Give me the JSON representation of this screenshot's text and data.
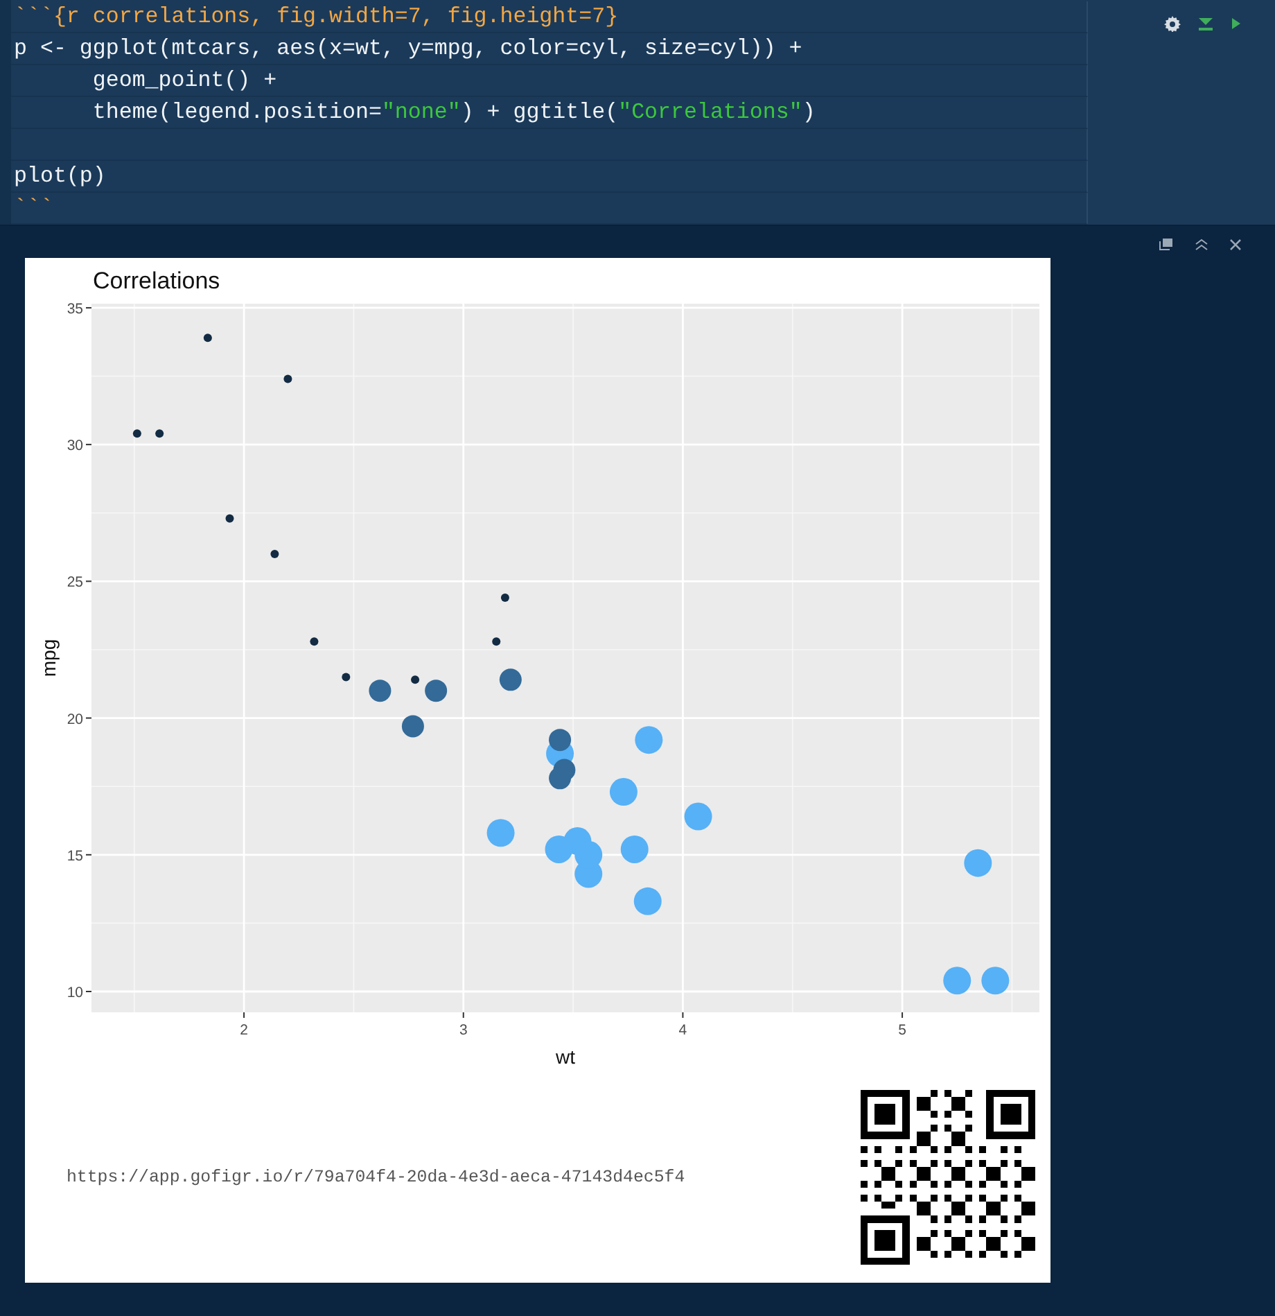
{
  "editor": {
    "lines": [
      [
        {
          "kind": "chunk",
          "text": "```{r correlations, fig.width=7, fig.height=7}"
        }
      ],
      [
        {
          "kind": "plain",
          "text": "p <- ggplot(mtcars, aes(x=wt, y=mpg, color=cyl, size=cyl)) +"
        }
      ],
      [
        {
          "kind": "plain",
          "text": "      geom_point() +"
        }
      ],
      [
        {
          "kind": "plain",
          "text": "      theme(legend.position="
        },
        {
          "kind": "string",
          "text": "\"none\""
        },
        {
          "kind": "plain",
          "text": ") + ggtitle("
        },
        {
          "kind": "string",
          "text": "\"Correlations\""
        },
        {
          "kind": "plain",
          "text": ")"
        }
      ],
      {
        "kind": "blank"
      },
      [
        {
          "kind": "plain",
          "text": "plot(p)"
        }
      ],
      [
        {
          "kind": "chunk",
          "text": "```"
        }
      ]
    ]
  },
  "output": {
    "chart_data": {
      "type": "scatter",
      "grid": true,
      "title": "Correlations",
      "xlabel": "wt",
      "ylabel": "mpg",
      "xlim": [
        1.305,
        5.625
      ],
      "ylim": [
        9.24,
        35.15
      ],
      "xticks": [
        2,
        3,
        4,
        5
      ],
      "yticks": [
        10,
        15,
        20,
        25,
        30,
        35
      ],
      "series": [
        {
          "color": "#132b43",
          "x": [
            2.32,
            3.19,
            3.15,
            2.2,
            1.615,
            1.835,
            2.465,
            1.935,
            2.14,
            1.513,
            2.78
          ],
          "values": [
            22.8,
            24.4,
            22.8,
            32.4,
            30.4,
            33.9,
            21.5,
            27.3,
            26.0,
            30.4,
            21.4
          ]
        },
        {
          "color": "#336a98",
          "x": [
            2.62,
            2.875,
            3.215,
            3.46,
            3.44,
            3.44,
            2.77
          ],
          "values": [
            21.0,
            21.0,
            21.4,
            18.1,
            19.2,
            17.8,
            19.7
          ]
        },
        {
          "color": "#56b1f7",
          "x": [
            3.44,
            3.57,
            4.07,
            3.73,
            3.78,
            5.25,
            5.424,
            5.345,
            3.52,
            3.435,
            3.84,
            3.845,
            3.17,
            3.57
          ],
          "values": [
            18.7,
            14.3,
            16.4,
            17.3,
            15.2,
            10.4,
            10.4,
            14.7,
            15.5,
            15.2,
            13.3,
            19.2,
            15.8,
            15.0
          ]
        }
      ]
    },
    "url": "https://app.gofigr.io/r/79a704f4-20da-4e3d-aeca-47143d4ec5f4"
  }
}
